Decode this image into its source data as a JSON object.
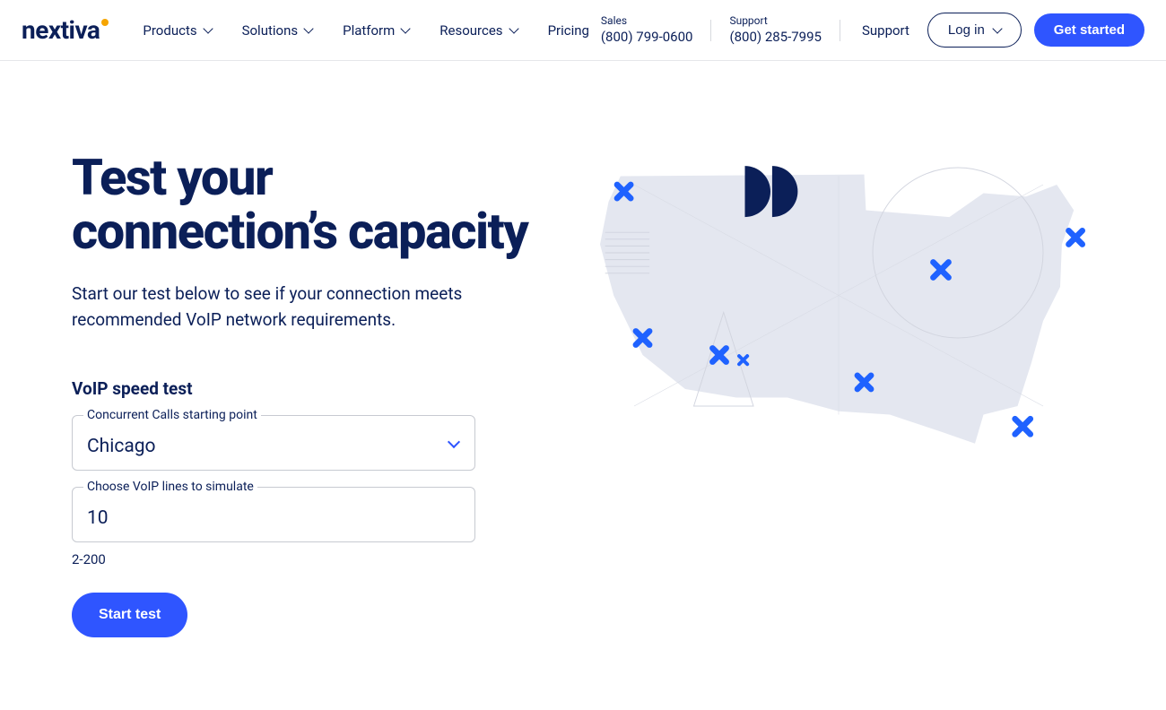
{
  "brand": {
    "name": "nextiva"
  },
  "nav": {
    "items": [
      {
        "label": "Products",
        "has_dropdown": true
      },
      {
        "label": "Solutions",
        "has_dropdown": true
      },
      {
        "label": "Platform",
        "has_dropdown": true
      },
      {
        "label": "Resources",
        "has_dropdown": true
      },
      {
        "label": "Pricing",
        "has_dropdown": false
      }
    ]
  },
  "contacts": {
    "sales": {
      "label": "Sales",
      "phone": "(800) 799-0600"
    },
    "support": {
      "label": "Support",
      "phone": "(800) 285-7995"
    }
  },
  "support_link": "Support",
  "actions": {
    "login": "Log in",
    "get_started": "Get started"
  },
  "hero": {
    "title": "Test your connection’s capacity",
    "subtitle": "Start our test below to see if your connection meets recommended VoIP network requirements."
  },
  "form": {
    "title": "VoIP speed test",
    "starting_point": {
      "label": "Concurrent Calls starting point",
      "value": "Chicago"
    },
    "lines": {
      "label": "Choose VoIP lines to simulate",
      "value": "10",
      "hint": "2-200"
    },
    "submit": "Start test"
  },
  "colors": {
    "accent": "#2f55ff",
    "navy": "#0b1f58",
    "map_fill": "#e4e7f0"
  }
}
